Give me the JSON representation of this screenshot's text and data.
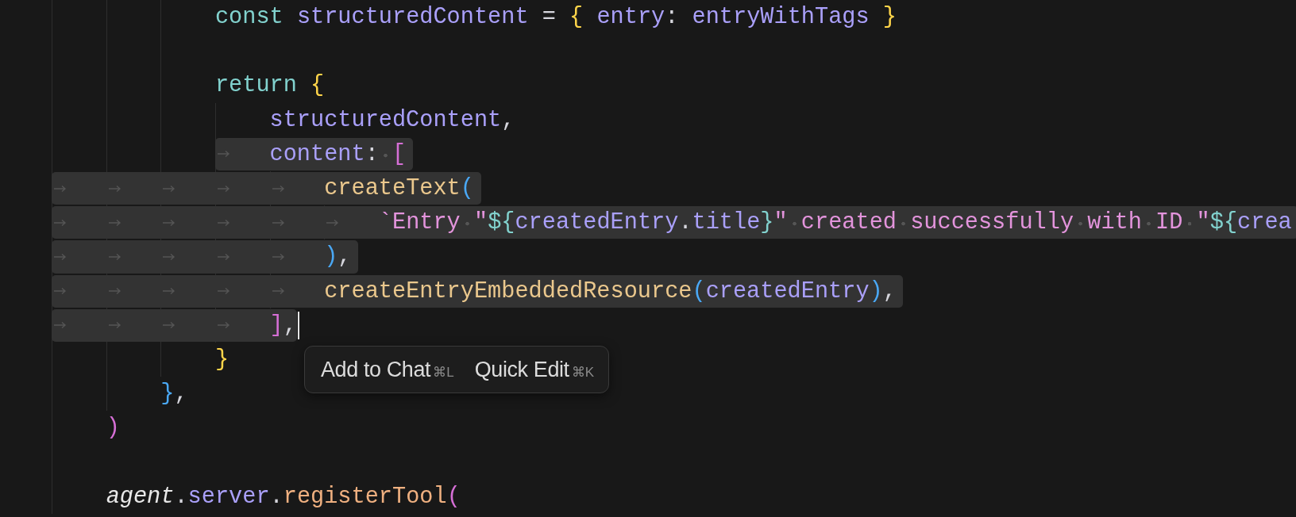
{
  "editor": {
    "lines": [
      {
        "kind": "group",
        "children": [
          {
            "kind": "group",
            "children": [
              {
                "kind": "code",
                "selected": false,
                "tokens": [
                  {
                    "text": "const ",
                    "kind": "keyword"
                  },
                  {
                    "text": "structuredContent",
                    "kind": "variable"
                  },
                  {
                    "text": " = ",
                    "kind": "punct"
                  },
                  {
                    "text": "{",
                    "kind": "bracket1"
                  },
                  {
                    "text": " entry",
                    "kind": "variable"
                  },
                  {
                    "text": ": ",
                    "kind": "punct"
                  },
                  {
                    "text": "entryWithTags",
                    "kind": "variable"
                  },
                  {
                    "text": " }",
                    "kind": "bracket1"
                  }
                ]
              },
              {
                "kind": "blank"
              },
              {
                "kind": "code",
                "selected": false,
                "tokens": [
                  {
                    "text": "return ",
                    "kind": "keyword"
                  },
                  {
                    "text": "{",
                    "kind": "bracket1"
                  }
                ],
                "children": [
                  {
                    "kind": "code",
                    "selected": false,
                    "tokens": [
                      {
                        "text": "structuredContent",
                        "kind": "variable"
                      },
                      {
                        "text": ",",
                        "kind": "punct"
                      }
                    ]
                  },
                  {
                    "kind": "code",
                    "selected": true,
                    "partial": true,
                    "tokens": [
                      {
                        "text": "content",
                        "kind": "variable"
                      },
                      {
                        "text": ": ",
                        "kind": "punct"
                      },
                      {
                        "text": "[",
                        "kind": "bracket2"
                      }
                    ],
                    "children": [
                      {
                        "kind": "code",
                        "selected": true,
                        "tokens": [
                          {
                            "text": "createText",
                            "kind": "function"
                          },
                          {
                            "text": "(",
                            "kind": "bracket3"
                          }
                        ],
                        "children": [
                          {
                            "kind": "code",
                            "selected": true,
                            "tokens": [
                              {
                                "text": "`Entry \"",
                                "kind": "string"
                              },
                              {
                                "text": "${",
                                "kind": "interp"
                              },
                              {
                                "text": "createdEntry",
                                "kind": "variable"
                              },
                              {
                                "text": ".",
                                "kind": "punct"
                              },
                              {
                                "text": "title",
                                "kind": "variable"
                              },
                              {
                                "text": "}",
                                "kind": "interp"
                              },
                              {
                                "text": "\" created successfully with ID \"",
                                "kind": "string"
                              },
                              {
                                "text": "${",
                                "kind": "interp"
                              },
                              {
                                "text": "crea",
                                "kind": "variable"
                              }
                            ]
                          }
                        ]
                      },
                      {
                        "kind": "code",
                        "selected": true,
                        "tokens": [
                          {
                            "text": ")",
                            "kind": "bracket3"
                          },
                          {
                            "text": ",",
                            "kind": "punct"
                          }
                        ]
                      },
                      {
                        "kind": "code",
                        "selected": true,
                        "tokens": [
                          {
                            "text": "createEntryEmbeddedResource",
                            "kind": "function"
                          },
                          {
                            "text": "(",
                            "kind": "bracket3"
                          },
                          {
                            "text": "createdEntry",
                            "kind": "variable"
                          },
                          {
                            "text": ")",
                            "kind": "bracket3"
                          },
                          {
                            "text": ",",
                            "kind": "punct"
                          }
                        ]
                      }
                    ]
                  },
                  {
                    "kind": "code",
                    "selected": true,
                    "cursor": true,
                    "tokens": [
                      {
                        "text": "]",
                        "kind": "bracket2"
                      },
                      {
                        "text": ",",
                        "kind": "punct"
                      }
                    ]
                  }
                ]
              },
              {
                "kind": "code",
                "selected": false,
                "tokens": [
                  {
                    "text": "}",
                    "kind": "bracket1"
                  }
                ]
              }
            ]
          },
          {
            "kind": "code",
            "selected": false,
            "tokens": [
              {
                "text": "}",
                "kind": "bracket3"
              },
              {
                "text": ",",
                "kind": "punct"
              }
            ]
          }
        ]
      },
      {
        "kind": "code",
        "selected": false,
        "tokens": [
          {
            "text": ")",
            "kind": "bracket2"
          }
        ]
      },
      {
        "kind": "blank"
      },
      {
        "kind": "code",
        "selected": false,
        "tokens": [
          {
            "text": "agent",
            "kind": "object"
          },
          {
            "text": ".",
            "kind": "punct"
          },
          {
            "text": "server",
            "kind": "variable"
          },
          {
            "text": ".",
            "kind": "punct"
          },
          {
            "text": "registerTool",
            "kind": "method"
          },
          {
            "text": "(",
            "kind": "bracket2"
          }
        ]
      }
    ]
  },
  "popup": {
    "actions": [
      {
        "label": "Add to Chat",
        "shortcut": "⌘L"
      },
      {
        "label": "Quick Edit",
        "shortcut": "⌘K"
      }
    ]
  }
}
